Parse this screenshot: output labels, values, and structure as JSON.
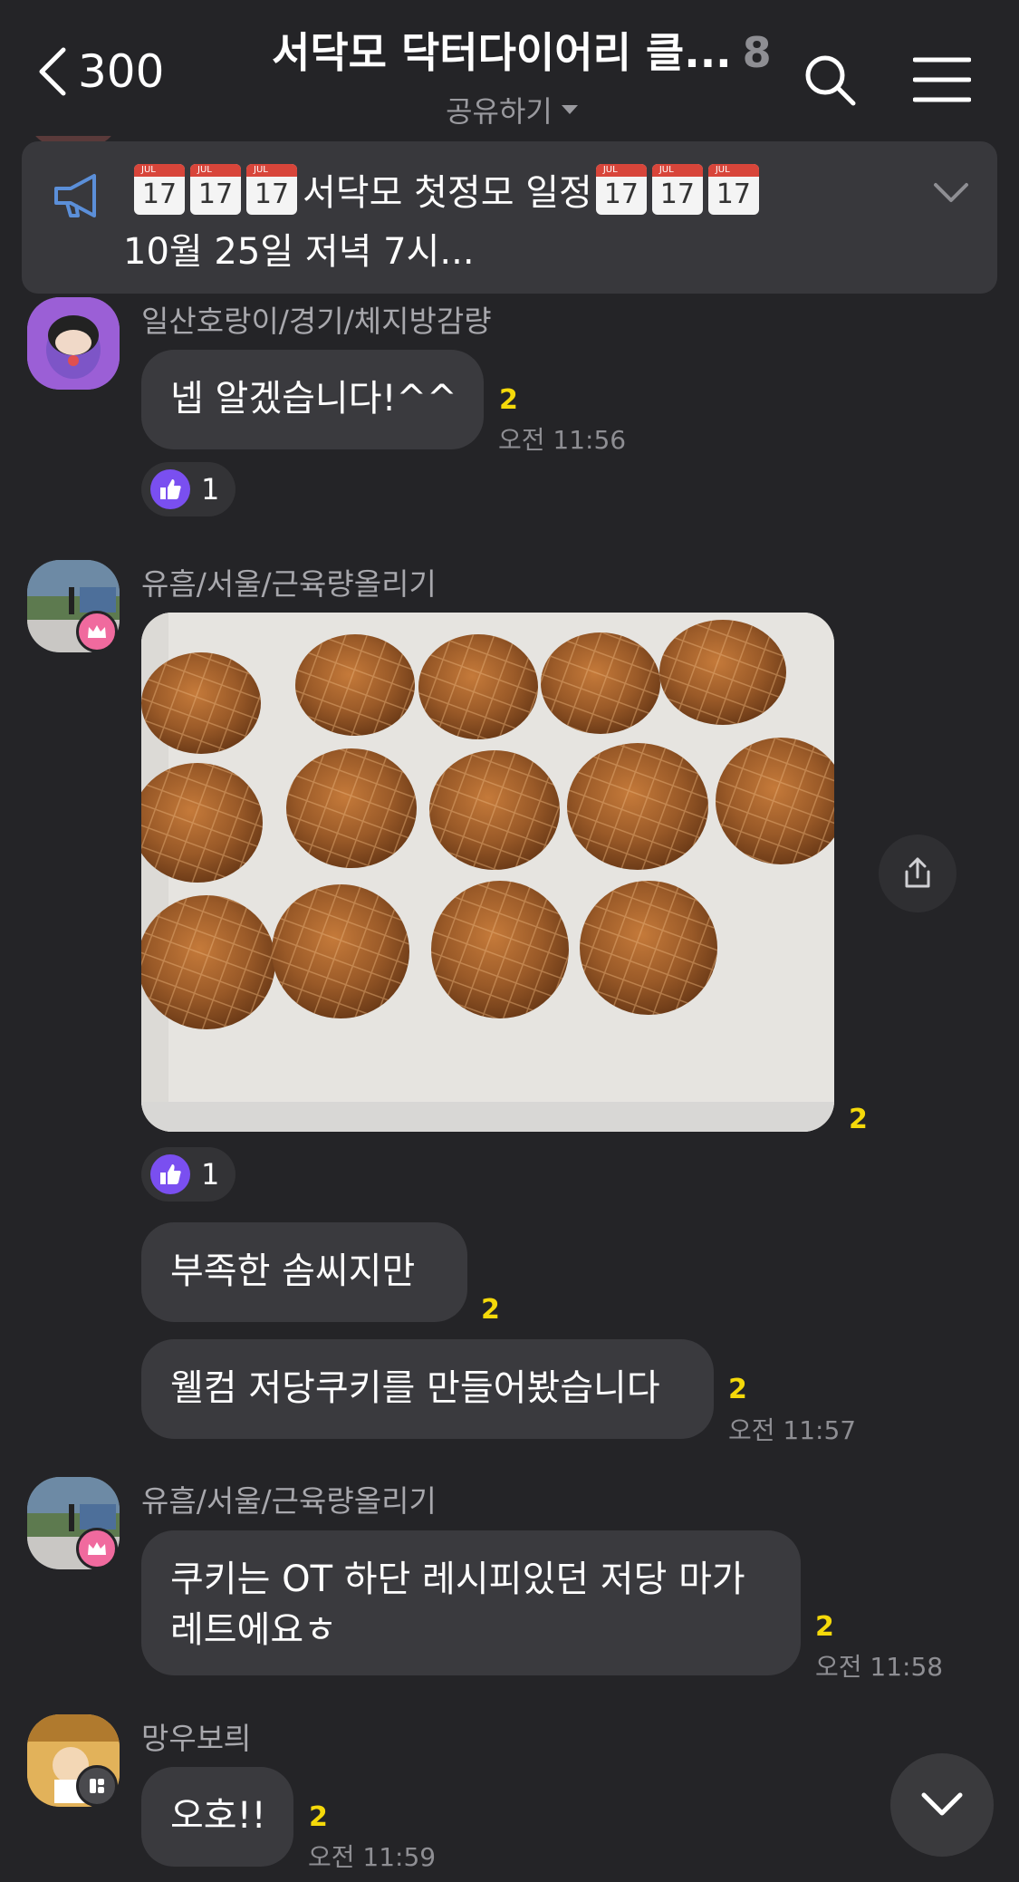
{
  "header": {
    "back_count": "300",
    "title": "서닥모 닥터다이어리 클...",
    "member_count": "8",
    "share_label": "공유하기"
  },
  "notice": {
    "icon": "megaphone-icon",
    "emoji_day": "17",
    "line1": "서닥모 첫정모 일정",
    "line2": "10월 25일 저녁 7시..."
  },
  "messages": [
    {
      "sender": "일산호랑이/경기/체지방감량",
      "text": "넵 알겠습니다!^^",
      "unread": "2",
      "time": "오전 11:56",
      "reaction_count": "1"
    },
    {
      "sender": "유흠/서울/근육량올리기",
      "photo_unread": "2",
      "reaction_count": "1",
      "text1": "부족한 솜씨지만",
      "unread1": "2",
      "text2": "웰컴 저당쿠키를 만들어봤습니다",
      "unread2": "2",
      "time2": "오전 11:57"
    },
    {
      "sender": "유흠/서울/근육량올리기",
      "line1": "쿠키는 OT 하단 레시피있던 저당 마가",
      "line2": "레트에요ㅎ",
      "unread": "2",
      "time": "오전 11:58"
    },
    {
      "sender": "망우보릐",
      "text": "오호!!",
      "unread": "2",
      "time": "오전 11:59"
    }
  ],
  "colors": {
    "background": "#242427",
    "bubble": "#3a3a3e",
    "unread": "#f5d90a",
    "reaction": "#7a4ff0",
    "crown_badge": "#f06a9e"
  }
}
